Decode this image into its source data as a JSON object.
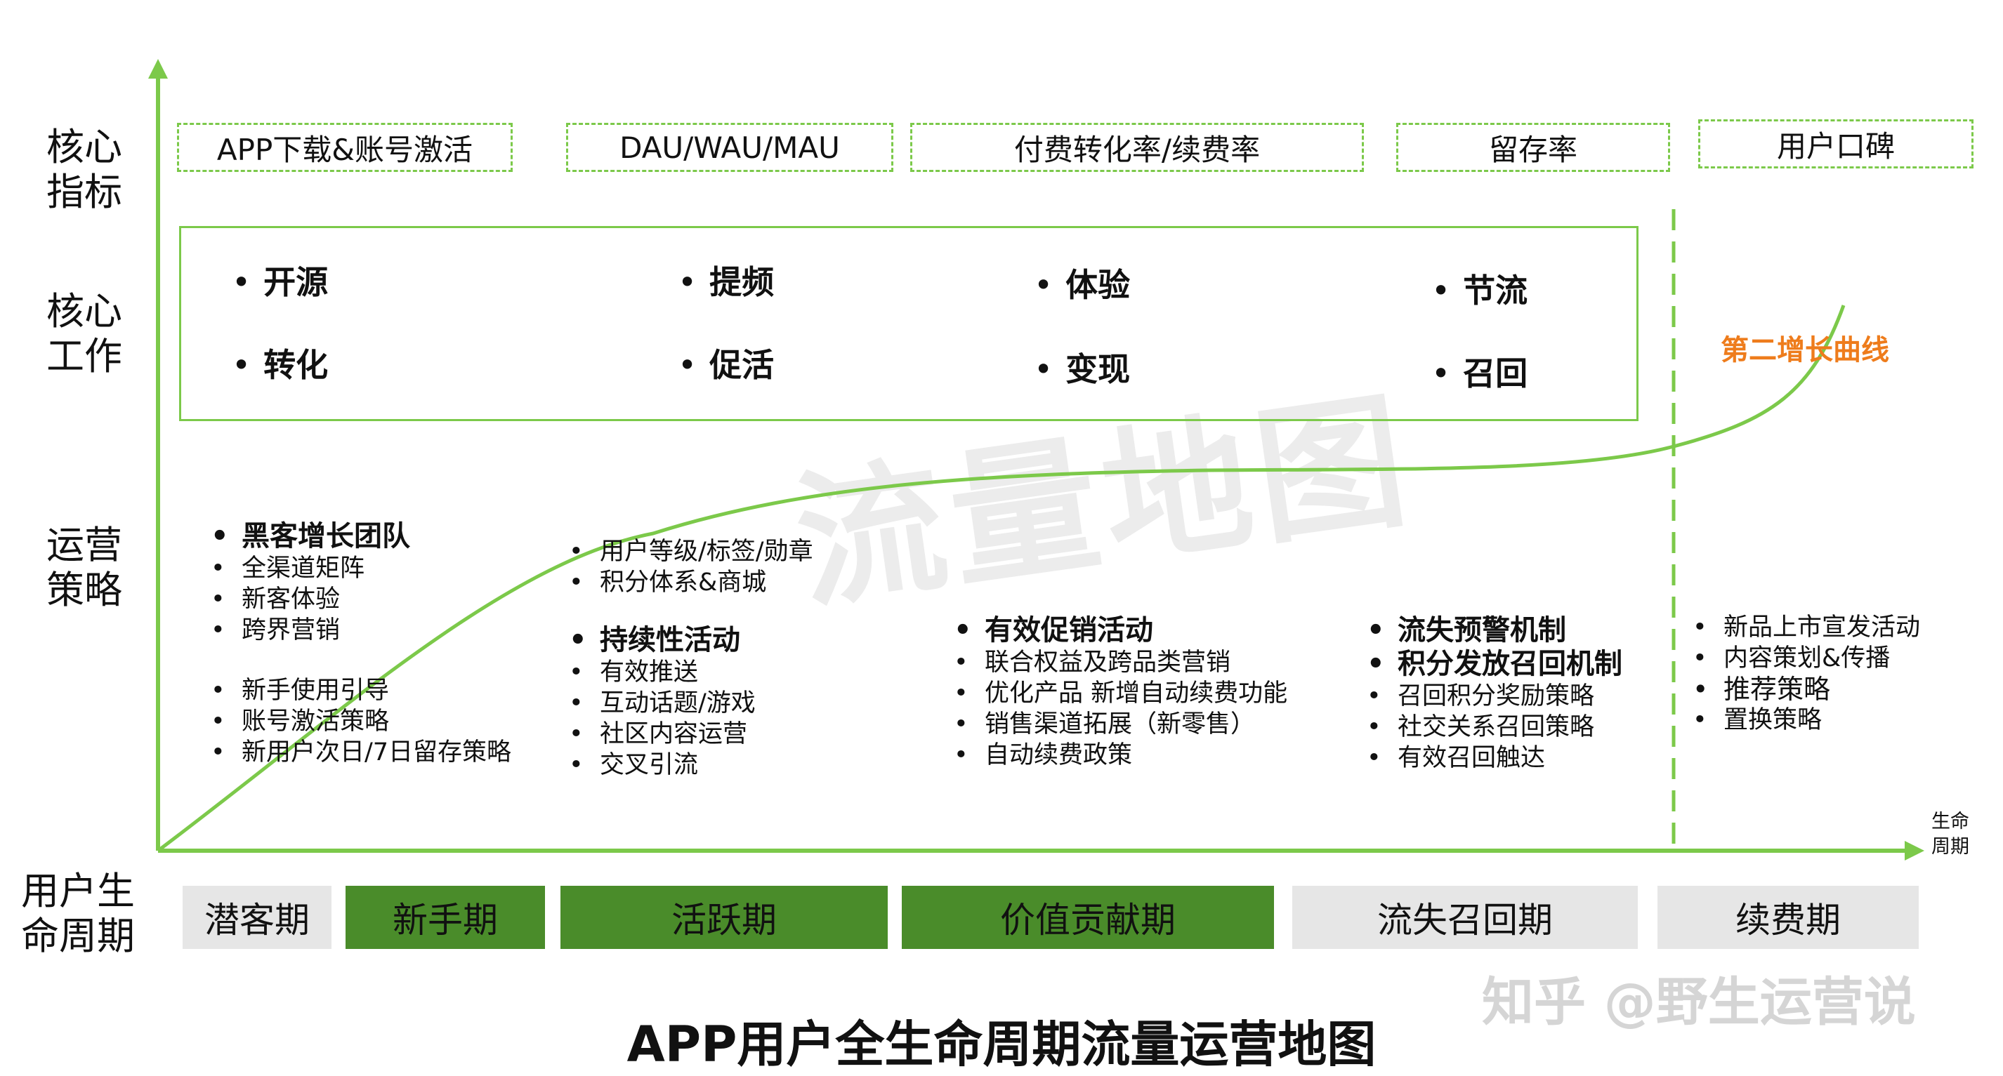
{
  "title": "APP用户全生命周期流量运营地图",
  "watermark": "流量地图",
  "credit": "知乎 @野生运营说",
  "row_labels": {
    "metrics": "核心\n指标",
    "work": "核心\n工作",
    "strategy": "运营\n策略",
    "lifecycle": "用户生\n命周期"
  },
  "axis_label": "生命\n周期",
  "metrics": [
    "APP下载&账号激活",
    "DAU/WAU/MAU",
    "付费转化率/续费率",
    "留存率",
    "用户口碑"
  ],
  "core_work": [
    {
      "top": "开源",
      "bottom": "转化"
    },
    {
      "top": "提频",
      "bottom": "促活"
    },
    {
      "top": "体验",
      "bottom": "变现"
    },
    {
      "top": "节流",
      "bottom": "召回"
    }
  ],
  "second_curve_label": "第二增长曲线",
  "strategies": {
    "col1": {
      "group1_bold": "黑客增长团队",
      "group1": [
        "全渠道矩阵",
        "新客体验",
        "跨界营销"
      ],
      "group2": [
        "新手使用引导",
        "账号激活策略",
        "新用户次日/7日留存策略"
      ]
    },
    "col2": {
      "group1": [
        "用户等级/标签/勋章",
        "积分体系&商城"
      ],
      "group2_bold": "持续性活动",
      "group2": [
        "有效推送",
        "互动话题/游戏",
        "社区内容运营",
        "交叉引流"
      ]
    },
    "col3": {
      "bold": "有效促销活动",
      "items": [
        "联合权益及跨品类营销",
        "优化产品 新增自动续费功能",
        "销售渠道拓展（新零售）",
        "自动续费政策"
      ]
    },
    "col4": {
      "bold1": "流失预警机制",
      "bold2": "积分发放召回机制",
      "items": [
        "召回积分奖励策略",
        "社交关系召回策略",
        "有效召回触达"
      ]
    },
    "col5": {
      "item1": "新品上市宣发活动",
      "item2": "内容策划&传播",
      "item3": "推荐策略",
      "item4": "置换策略"
    }
  },
  "phases": [
    {
      "label": "潜客期",
      "style": "grey"
    },
    {
      "label": "新手期",
      "style": "green"
    },
    {
      "label": "活跃期",
      "style": "green"
    },
    {
      "label": "价值贡献期",
      "style": "green"
    },
    {
      "label": "流失召回期",
      "style": "grey"
    },
    {
      "label": "续费期",
      "style": "grey"
    }
  ],
  "colors": {
    "accent_green": "#7cc94a",
    "phase_green": "#4a8c2a",
    "phase_grey": "#e6e6e6",
    "second_curve": "#ee7c1c"
  }
}
